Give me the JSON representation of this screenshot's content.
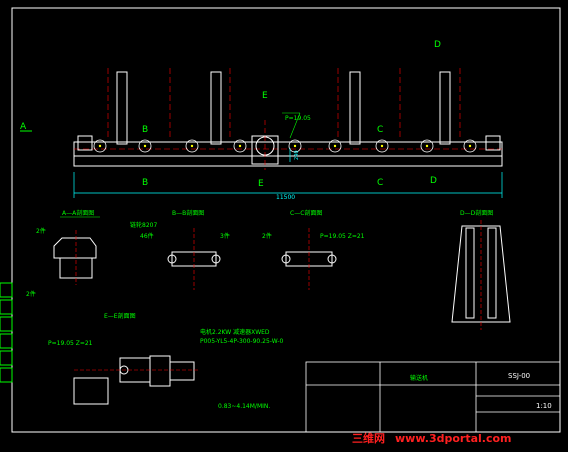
{
  "dimensions": {
    "overall_length": "11500",
    "height": "240"
  },
  "markers": {
    "a": "A",
    "b": "B",
    "c": "C",
    "d": "D",
    "e": "E"
  },
  "main_notes": {
    "pitch_label": "P=19.05"
  },
  "sections": {
    "a": {
      "title": "A—A剖面图",
      "note1": "2件",
      "note2": "2件"
    },
    "b": {
      "title": "B—B剖面图",
      "note1": "46件",
      "note2": "3件",
      "note3": "链轮8207"
    },
    "c": {
      "title": "C—C剖面图",
      "note1": "2件",
      "note2": "P=19.05 Z=21"
    },
    "d": {
      "title": "D—D剖面图"
    },
    "e": {
      "title": "E—E剖面图",
      "note1": "P=19.05 Z=21",
      "motor_line1": "电机2.2KW 减速器XWED",
      "motor_line2": "P005-YL5-4P-300-90.25-W-0",
      "speed_note": "0.83~4.14M/MIN."
    }
  },
  "title_block": {
    "drawing_no": "SSJ-00",
    "name": "输送机",
    "scale": "1:10"
  },
  "watermark": {
    "cn": "三维网",
    "url": "www.3dportal.com"
  },
  "colors": {
    "background": "#000000",
    "outline": "#ffffff",
    "section": "#00ff00",
    "center": "#ff0000",
    "dim": "#00ffff",
    "node": "#ffff00",
    "watermark": "#ff2020"
  }
}
